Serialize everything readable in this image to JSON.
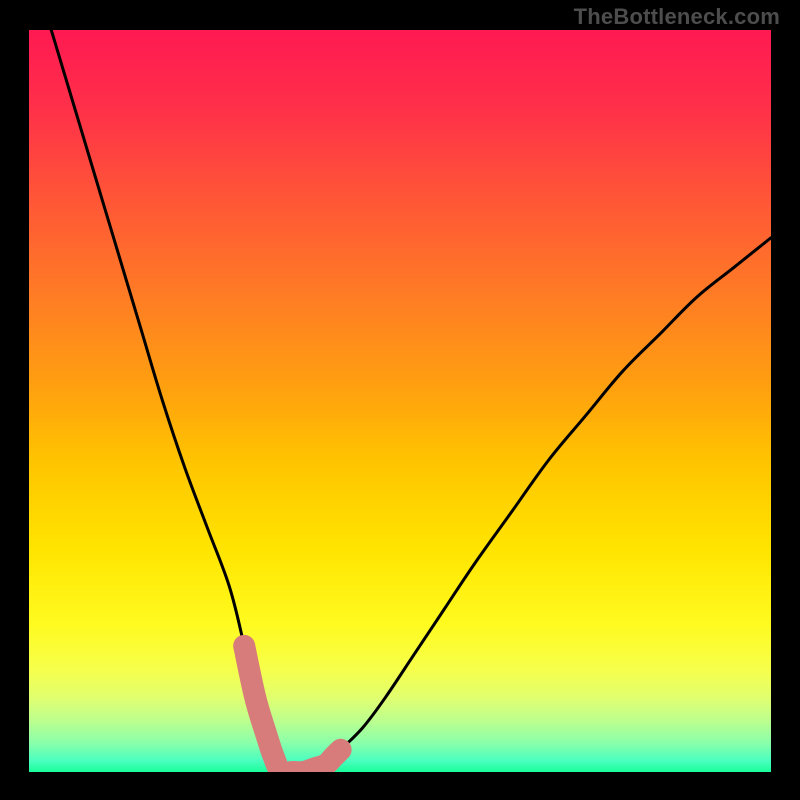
{
  "watermark": "TheBottleneck.com",
  "chart_data": {
    "type": "line",
    "title": "",
    "xlabel": "",
    "ylabel": "",
    "xlim": [
      0,
      100
    ],
    "ylim": [
      0,
      100
    ],
    "series": [
      {
        "name": "bottleneck-curve",
        "color": "#000000",
        "x": [
          3,
          6,
          9,
          12,
          15,
          18,
          21,
          24,
          27,
          29,
          30.5,
          32,
          33,
          34,
          36,
          38,
          40,
          42,
          45,
          48,
          52,
          56,
          60,
          65,
          70,
          75,
          80,
          85,
          90,
          95,
          100
        ],
        "y": [
          100,
          90,
          80,
          70,
          60,
          50,
          41,
          33,
          25,
          17,
          10,
          5,
          2,
          0,
          0,
          0,
          1,
          3,
          6,
          10,
          16,
          22,
          28,
          35,
          42,
          48,
          54,
          59,
          64,
          68,
          72
        ]
      },
      {
        "name": "highlighted-range",
        "color": "#d87b7b",
        "x": [
          29,
          30.5,
          32,
          33,
          34,
          35.5,
          37,
          38.5,
          40,
          41,
          42
        ],
        "y": [
          17,
          10,
          5,
          2,
          0,
          0,
          0,
          0.5,
          1,
          2,
          3
        ]
      }
    ],
    "gradient_stops": [
      {
        "pos": 0.0,
        "color": "#ff1a52"
      },
      {
        "pos": 0.1,
        "color": "#ff2f4a"
      },
      {
        "pos": 0.22,
        "color": "#ff5438"
      },
      {
        "pos": 0.35,
        "color": "#ff7a26"
      },
      {
        "pos": 0.48,
        "color": "#ffa010"
      },
      {
        "pos": 0.58,
        "color": "#ffc400"
      },
      {
        "pos": 0.7,
        "color": "#ffe500"
      },
      {
        "pos": 0.8,
        "color": "#fffb20"
      },
      {
        "pos": 0.86,
        "color": "#f7ff4a"
      },
      {
        "pos": 0.9,
        "color": "#e1ff70"
      },
      {
        "pos": 0.93,
        "color": "#beff8e"
      },
      {
        "pos": 0.96,
        "color": "#8cffaa"
      },
      {
        "pos": 0.985,
        "color": "#4affc0"
      },
      {
        "pos": 1.0,
        "color": "#1aff9a"
      }
    ]
  }
}
